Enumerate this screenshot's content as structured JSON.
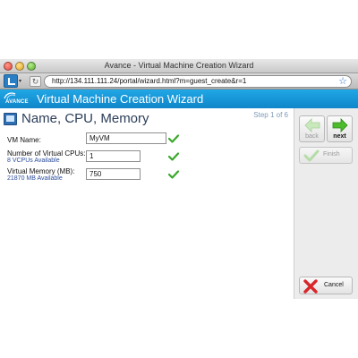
{
  "window": {
    "title": "Avance - Virtual Machine Creation Wizard"
  },
  "browser": {
    "url": "http://134.111.111.24/portal/wizard.html?m=guest_create&r=1",
    "dropdown_glyph": "▾",
    "refresh_glyph": "↻",
    "bookmark_glyph": "☆"
  },
  "header": {
    "brand": "AVANCE",
    "title": "Virtual Machine Creation Wizard"
  },
  "main": {
    "page_title": "Name, CPU, Memory",
    "step": "Step 1 of 6",
    "fields": {
      "vm_name": {
        "label": "VM Name:",
        "value": "MyVM"
      },
      "vcpus": {
        "label": "Number of Virtual CPUs:",
        "sub": "8 VCPUs Available",
        "value": "1"
      },
      "memory": {
        "label": "Virtual Memory (MB):",
        "sub": "21870 MB Available",
        "value": "750"
      }
    }
  },
  "side_panel": {
    "back_label": "back",
    "next_label": "next",
    "finish_label": "Finish",
    "cancel_label": "Cancel"
  },
  "colors": {
    "header_blue": "#1596d8",
    "check_green": "#3aa82a",
    "cancel_red": "#d9262b",
    "next_green": "#4cbb2c"
  }
}
